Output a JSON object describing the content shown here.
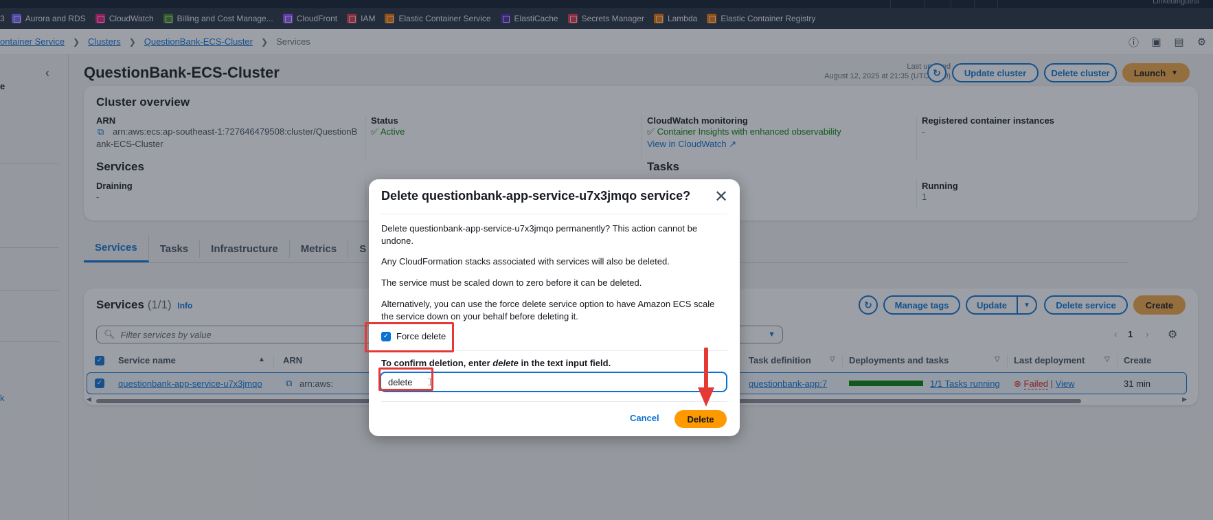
{
  "topbar": {
    "user_fragment": "Linkedinguest"
  },
  "favorites": [
    {
      "label": "3",
      "color": ""
    },
    {
      "label": "Aurora and RDS",
      "color": "#7b61ff"
    },
    {
      "label": "CloudWatch",
      "color": "#e7157b"
    },
    {
      "label": "Billing and Cost Manage...",
      "color": "#3f8624"
    },
    {
      "label": "CloudFront",
      "color": "#8c4fff"
    },
    {
      "label": "IAM",
      "color": "#dd344c"
    },
    {
      "label": "Elastic Container Service",
      "color": "#ed7100"
    },
    {
      "label": "ElastiCache",
      "color": "#4d27aa"
    },
    {
      "label": "Secrets Manager",
      "color": "#dd344c"
    },
    {
      "label": "Lambda",
      "color": "#ed7100"
    },
    {
      "label": "Elastic Container Registry",
      "color": "#ed7100"
    }
  ],
  "breadcrumb": {
    "items": [
      "ontainer Service",
      "Clusters",
      "QuestionBank-ECS-Cluster"
    ],
    "current": "Services"
  },
  "header_icons": [
    "info-icon",
    "screen-icon",
    "panel-icon",
    "settings-icon"
  ],
  "sidebar": {
    "frag_top": "e",
    "frag_bottom": "k"
  },
  "page": {
    "title": "QuestionBank-ECS-Cluster",
    "last_updated_label": "Last updated",
    "last_updated_value": "August 12, 2025 at 21:35 (UTC+7:00)",
    "update_cluster": "Update cluster",
    "delete_cluster": "Delete cluster",
    "launch": "Launch"
  },
  "overview": {
    "title": "Cluster overview",
    "arn_label": "ARN",
    "arn_value_1": "arn:aws:ecs:ap-southeast-1:727646479508:cluster/QuestionB",
    "arn_value_2": "ank-ECS-Cluster",
    "status_label": "Status",
    "status_value": "Active",
    "cloudwatch_label": "CloudWatch monitoring",
    "cloudwatch_value": "Container Insights with enhanced observability",
    "cloudwatch_link": "View in CloudWatch",
    "registered_label": "Registered container instances",
    "registered_value": "-",
    "services_title": "Services",
    "tasks_title_fragment": "Tasks",
    "draining_label": "Draining",
    "draining_value": "-",
    "running_label": "Running",
    "running_value": "1"
  },
  "tabs": [
    "Services",
    "Tasks",
    "Infrastructure",
    "Metrics",
    "S"
  ],
  "services_panel": {
    "title": "Services",
    "count": "(1/1)",
    "info": "Info",
    "manage_tags": "Manage tags",
    "update": "Update",
    "delete_service": "Delete service",
    "create": "Create",
    "filter_placeholder": "Filter services by value",
    "page_number": "1",
    "columns": {
      "service_name": "Service name",
      "arn": "ARN",
      "task_definition": "Task definition",
      "deployments": "Deployments and tasks",
      "last_deployment": "Last deployment",
      "created": "Create"
    },
    "row": {
      "service_name": "questionbank-app-service-u7x3jmqo",
      "arn_fragment": "arn:aws:",
      "task_definition": "questionbank-app:7",
      "tasks_running": "1/1 Tasks running",
      "progress": 1.0,
      "last_deployment_status": "Failed",
      "view": "View",
      "created_fragment": "31 min"
    }
  },
  "modal": {
    "title": "Delete questionbank-app-service-u7x3jmqo service?",
    "p1": "Delete questionbank-app-service-u7x3jmqo permanently? This action cannot be undone.",
    "p2": "Any CloudFormation stacks associated with services will also be deleted.",
    "p3": "The service must be scaled down to zero before it can be deleted.",
    "p4": "Alternatively, you can use the force delete service option to have Amazon ECS scale the service down on your behalf before deleting it.",
    "force_delete": "Force delete",
    "confirm_prefix": "To confirm deletion, enter ",
    "confirm_word": "delete",
    "confirm_suffix": " in the text input field.",
    "input_value": "delete",
    "cancel": "Cancel",
    "delete": "Delete"
  },
  "colors": {
    "primary": "#0972d3",
    "accent": "#ff9900",
    "success": "#037f0c",
    "error": "#d91515",
    "annotation": "#e53935"
  }
}
